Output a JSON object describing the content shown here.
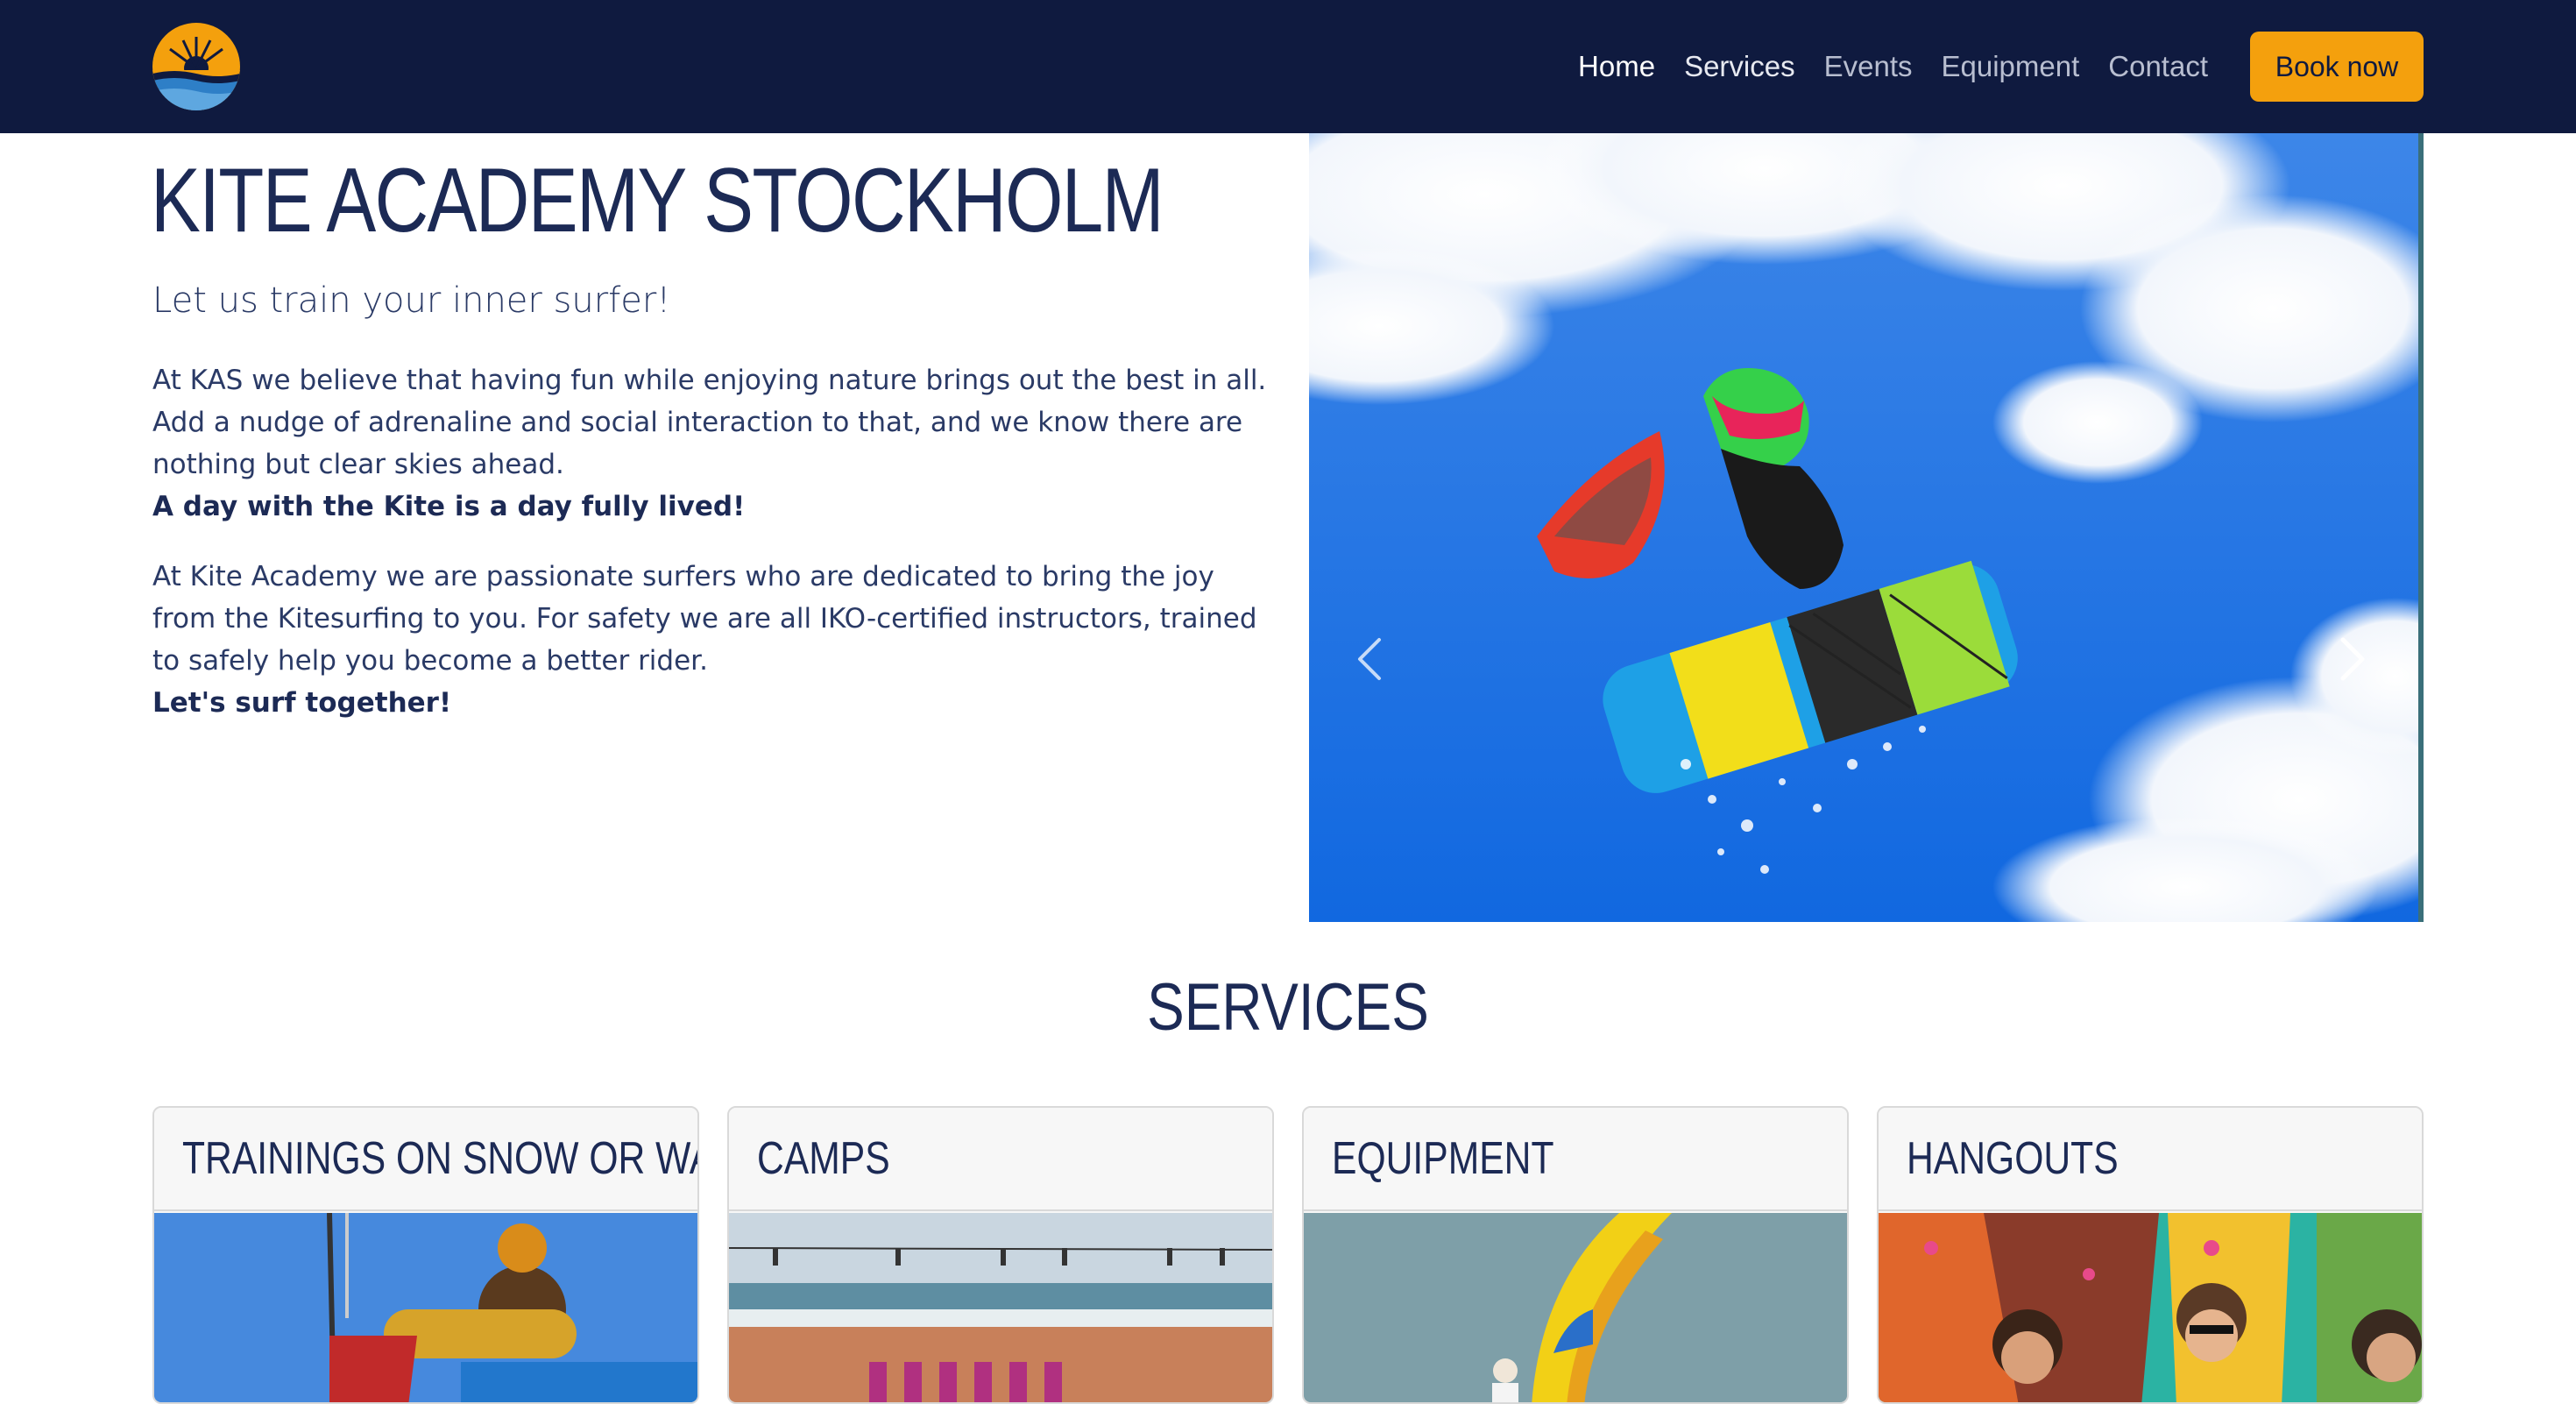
{
  "navbar": {
    "logo_icon": "sunset-wave-logo-icon",
    "links": [
      {
        "label": "Home",
        "active": true
      },
      {
        "label": "Services",
        "active": false
      },
      {
        "label": "Events",
        "active": false
      },
      {
        "label": "Equipment",
        "active": false
      },
      {
        "label": "Contact",
        "active": false
      }
    ],
    "book_button": "Book now"
  },
  "hero": {
    "title": "KITE ACADEMY STOCKHOLM",
    "subtitle": "Let us train your inner surfer!",
    "paragraph1": "At KAS we believe that having fun while enjoying nature brings out the best in all. Add a nudge of adrenaline and social interaction to that, and we know there are nothing but clear skies ahead.",
    "paragraph1_bold": "A day with the Kite is a day fully lived!",
    "paragraph2": "At Kite Academy we are passionate surfers who are dedicated to bring the joy from the Kitesurfing to you. For safety we are all IKO-certified instructors, trained to safely help you become a better rider.",
    "paragraph2_bold": "Let's surf together!"
  },
  "carousel": {
    "prev_icon": "chevron-left-icon",
    "next_icon": "chevron-right-icon"
  },
  "services": {
    "title": "SERVICES",
    "cards": [
      {
        "title": "TRAININGS ON SNOW OR WATER"
      },
      {
        "title": "CAMPS"
      },
      {
        "title": "EQUIPMENT"
      },
      {
        "title": "HANGOUTS"
      }
    ]
  },
  "colors": {
    "navbar_bg": "#0f1a3f",
    "accent": "#f4a00d",
    "text_primary": "#1c2a55"
  }
}
